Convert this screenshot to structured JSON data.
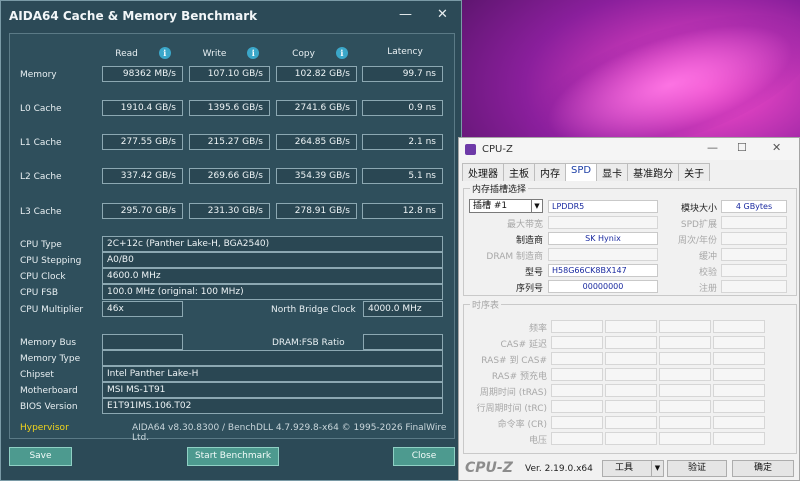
{
  "aida": {
    "title": "AIDA64 Cache & Memory Benchmark",
    "min_glyph": "—",
    "close_glyph": "✕",
    "columns": [
      "Read",
      "Write",
      "Copy",
      "Latency"
    ],
    "info_glyph": "i",
    "rows": [
      {
        "label": "Memory",
        "read": "98362 MB/s",
        "write": "107.10 GB/s",
        "copy": "102.82 GB/s",
        "latency": "99.7 ns"
      },
      {
        "label": "L0 Cache",
        "read": "1910.4 GB/s",
        "write": "1395.6 GB/s",
        "copy": "2741.6 GB/s",
        "latency": "0.9 ns"
      },
      {
        "label": "L1 Cache",
        "read": "277.55 GB/s",
        "write": "215.27 GB/s",
        "copy": "264.85 GB/s",
        "latency": "2.1 ns"
      },
      {
        "label": "L2 Cache",
        "read": "337.42 GB/s",
        "write": "269.66 GB/s",
        "copy": "354.39 GB/s",
        "latency": "5.1 ns"
      },
      {
        "label": "L3 Cache",
        "read": "295.70 GB/s",
        "write": "231.30 GB/s",
        "copy": "278.91 GB/s",
        "latency": "12.8 ns"
      }
    ],
    "info": {
      "cpu_type_label": "CPU Type",
      "cpu_type": "2C+12c   (Panther Lake-H, BGA2540)",
      "cpu_stepping_label": "CPU Stepping",
      "cpu_stepping": "A0/B0",
      "cpu_clock_label": "CPU Clock",
      "cpu_clock": "4600.0 MHz",
      "cpu_fsb_label": "CPU FSB",
      "cpu_fsb": "100.0 MHz  (original: 100 MHz)",
      "cpu_mult_label": "CPU Multiplier",
      "cpu_mult": "46x",
      "nb_clock_label": "North Bridge Clock",
      "nb_clock": "4000.0 MHz",
      "mem_bus_label": "Memory Bus",
      "mem_bus": "",
      "dram_fsb_label": "DRAM:FSB Ratio",
      "dram_fsb": "",
      "mem_type_label": "Memory Type",
      "mem_type": "",
      "chipset_label": "Chipset",
      "chipset": "Intel Panther Lake-H",
      "motherboard_label": "Motherboard",
      "motherboard": "MSI MS-1T91",
      "bios_label": "BIOS Version",
      "bios": "E1T91IMS.106.T02"
    },
    "hypervisor": "Hypervisor",
    "copyright": "AIDA64 v8.30.8300 / BenchDLL 4.7.929.8-x64  © 1995-2026 FinalWire Ltd.",
    "buttons": {
      "save": "Save",
      "start": "Start Benchmark",
      "close": "Close"
    }
  },
  "cpuz": {
    "title": "CPU-Z",
    "min_glyph": "—",
    "max_glyph": "☐",
    "close_glyph": "✕",
    "tabs": [
      "处理器",
      "主板",
      "内存",
      "SPD",
      "显卡",
      "基准跑分",
      "关于"
    ],
    "active_tab": "SPD",
    "slot_group": "内存插槽选择",
    "slot_value": "插槽 #1",
    "dropdown_glyph": "▼",
    "fields": {
      "type": "LPDDR5",
      "max_bandwidth_label": "最大带宽",
      "max_bandwidth": "",
      "manufacturer_label": "制造商",
      "manufacturer": "SK Hynix",
      "dram_mfr_label": "DRAM 制造商",
      "dram_mfr": "",
      "part_label": "型号",
      "part": "H58G66CK8BX147",
      "serial_label": "序列号",
      "serial": "00000000",
      "module_size_label": "模块大小",
      "module_size": "4 GBytes",
      "spd_ext_label": "SPD扩展",
      "spd_ext": "",
      "week_year_label": "周次/年份",
      "week_year": "",
      "buffered_label": "缓冲",
      "buffered": "",
      "corrected_label": "校验",
      "corrected": "",
      "registered_label": "注册",
      "registered": ""
    },
    "timings_group": "时序表",
    "timing_labels": [
      "频率",
      "CAS# 延迟",
      "RAS# 到 CAS#",
      "RAS# 预充电",
      "周期时间 (tRAS)",
      "行周期时间 (tRC)",
      "命令率 (CR)",
      "电压"
    ],
    "logo": "CPU-Z",
    "version": "Ver. 2.19.0.x64",
    "tools_label": "工具",
    "validate_label": "验证",
    "ok_label": "确定"
  }
}
